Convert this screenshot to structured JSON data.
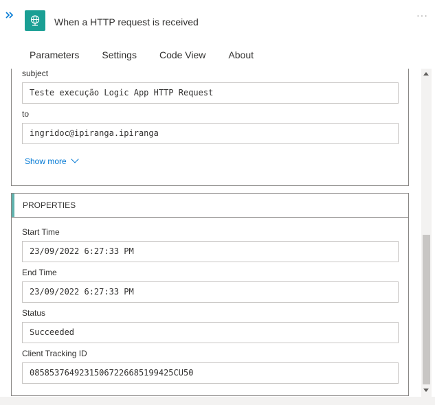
{
  "header": {
    "expand_icon": "double-chevron-right-icon",
    "trigger_icon": "globe-icon",
    "title": "When a HTTP request is received",
    "more_label": "···"
  },
  "tabs": [
    {
      "label": "Parameters",
      "active": true
    },
    {
      "label": "Settings",
      "active": false
    },
    {
      "label": "Code View",
      "active": false
    },
    {
      "label": "About",
      "active": false
    }
  ],
  "parameters": {
    "subject": {
      "label": "subject",
      "value": "Teste execução Logic App HTTP Request"
    },
    "to": {
      "label": "to",
      "value": "ingridoc@ipiranga.ipiranga"
    },
    "show_more": "Show more"
  },
  "properties": {
    "heading": "PROPERTIES",
    "start_time": {
      "label": "Start Time",
      "value": "23/09/2022 6:27:33 PM"
    },
    "end_time": {
      "label": "End Time",
      "value": "23/09/2022 6:27:33 PM"
    },
    "status": {
      "label": "Status",
      "value": "Succeeded"
    },
    "client_tracking_id": {
      "label": "Client Tracking ID",
      "value": "08585376492315067226685199425CU50"
    }
  },
  "colors": {
    "accent": "#0078d4",
    "trigger_icon_bg": "#1a9f94",
    "properties_accent": "#5fb2ad"
  }
}
